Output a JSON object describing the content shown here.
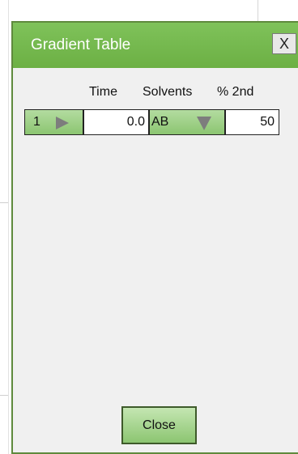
{
  "window": {
    "title": "Gradient Table",
    "close_icon_label": "X"
  },
  "table": {
    "headers": {
      "time": "Time",
      "solvents": "Solvents",
      "percent_second": "% 2nd"
    },
    "rows": [
      {
        "step": "1",
        "time": "0.0",
        "solvents": "AB",
        "percent_second": "50"
      }
    ]
  },
  "buttons": {
    "close": "Close"
  },
  "colors": {
    "title_bar": "#6cb044",
    "button_green": "#8cc571"
  }
}
